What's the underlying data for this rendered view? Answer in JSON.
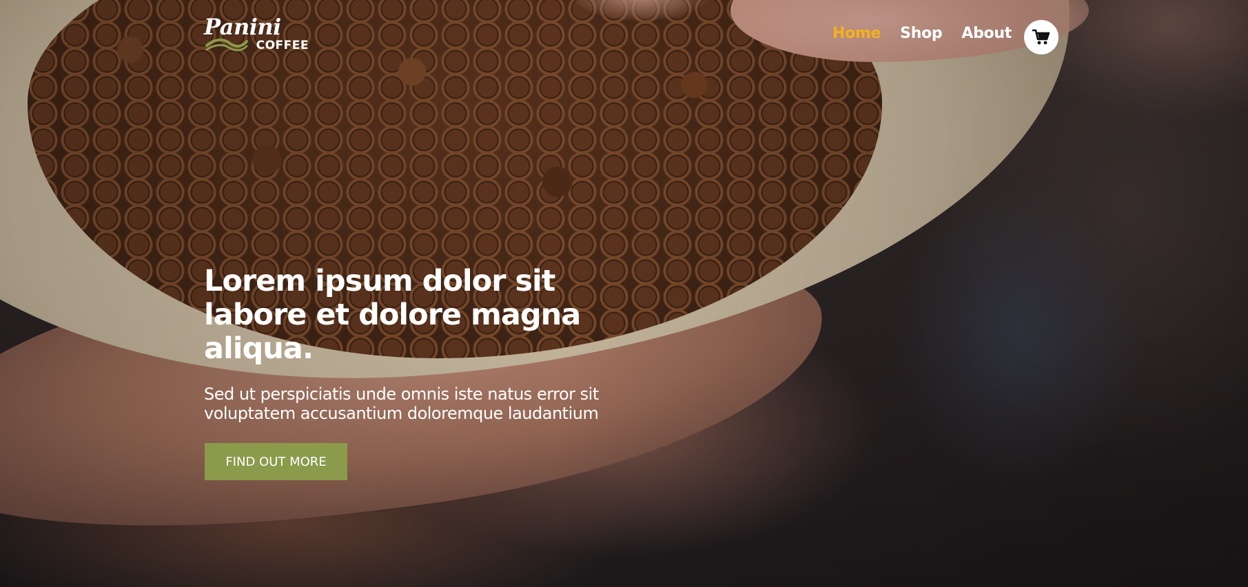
{
  "brand": {
    "logo_text": "Panini",
    "logo_subtext": "COFFEE",
    "accent_color": "#f5b01f",
    "logo_swoosh_color": "#8b9a4b"
  },
  "nav": {
    "items": [
      {
        "label": "Home",
        "active": true
      },
      {
        "label": "Shop",
        "active": false
      },
      {
        "label": "About",
        "active": false
      }
    ],
    "cart_icon": "cart-icon"
  },
  "hero": {
    "headline": "Lorem ipsum dolor sit labore et dolore magna aliqua.",
    "subtext": "Sed ut perspiciatis unde omnis iste natus error sit voluptatem accusantium doloremque laudantium",
    "cta_label": "FIND OUT MORE",
    "cta_color": "#8b9a4b"
  }
}
